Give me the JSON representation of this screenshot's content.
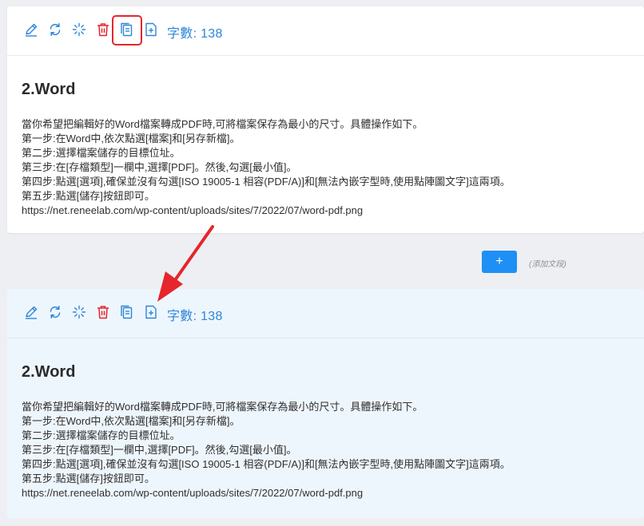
{
  "toolbar": {
    "icons": [
      "edit-icon",
      "refresh-icon",
      "sparkle-icon",
      "delete-icon",
      "copy-icon",
      "add-doc-icon"
    ],
    "word_count_label": "字數: 138",
    "accent_color": "#2d86d9",
    "delete_color": "#e5262c"
  },
  "blocks": [
    {
      "heading": "2.Word",
      "lines": [
        "當你希望把編輯好的Word檔案轉成PDF時,可將檔案保存為最小的尺寸。具體操作如下。",
        "第一步:在Word中,依次點選[檔案]和[另存新檔]。",
        "第二步:選擇檔案儲存的目標位址。",
        "第三步:在[存檔類型]一欄中,選擇[PDF]。然後,勾選[最小值]。",
        "第四步:點選[選項],確保並沒有勾選[ISO 19005-1 相容(PDF/A)]和[無法內嵌字型時,使用點陣圖文字]這兩項。",
        "第五步:點選[儲存]按鈕即可。",
        "https://net.reneelab.com/wp-content/uploads/sites/7/2022/07/word-pdf.png"
      ]
    },
    {
      "heading": "2.Word",
      "lines": [
        "當你希望把編輯好的Word檔案轉成PDF時,可將檔案保存為最小的尺寸。具體操作如下。",
        "第一步:在Word中,依次點選[檔案]和[另存新檔]。",
        "第二步:選擇檔案儲存的目標位址。",
        "第三步:在[存檔類型]一欄中,選擇[PDF]。然後,勾選[最小值]。",
        "第四步:點選[選項],確保並沒有勾選[ISO 19005-1 相容(PDF/A)]和[無法內嵌字型時,使用點陣圖文字]這兩項。",
        "第五步:點選[儲存]按鈕即可。",
        "https://net.reneelab.com/wp-content/uploads/sites/7/2022/07/word-pdf.png"
      ]
    }
  ],
  "add_section": {
    "button_label": "+",
    "hint": "(添加文段)",
    "button_color": "#1e90f5"
  },
  "annotation": {
    "arrow_color": "#e5262c",
    "highlight_color": "#e5262c"
  }
}
